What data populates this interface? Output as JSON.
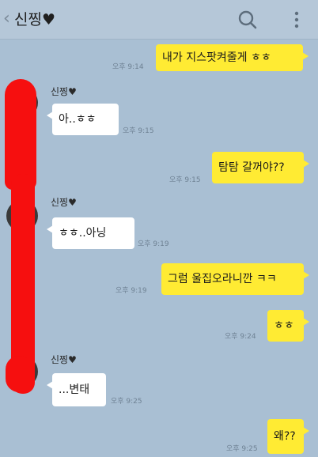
{
  "header": {
    "back_icon": "chevron-left-icon",
    "title": "신찡",
    "title_suffix": "♥",
    "search_icon": "search-icon",
    "menu_icon": "more-vertical-icon"
  },
  "colors": {
    "background": "#a9bfd3",
    "my_bubble": "#ffeb33",
    "their_bubble": "#ffffff",
    "redaction": "#f60f0f"
  },
  "messages": [
    {
      "from": "me",
      "text": "내가 지스팟켜줄게 ㅎㅎ",
      "time": "오후 9:14"
    },
    {
      "from": "them",
      "sender": "신찡♥",
      "text": "아..ㅎㅎ",
      "time": "오후 9:15"
    },
    {
      "from": "me",
      "text": "탐탐 갈꺼야??",
      "time": "오후 9:15"
    },
    {
      "from": "them",
      "sender": "신찡♥",
      "text": "ㅎㅎ..아닝",
      "time": "오후 9:19"
    },
    {
      "from": "me",
      "text": "그럼 울집오라니깐 ㅋㅋ",
      "time": "오후 9:19"
    },
    {
      "from": "me",
      "text": "ㅎㅎ",
      "time": "오후 9:24"
    },
    {
      "from": "them",
      "sender": "신찡♥",
      "text": "...변태",
      "time": "오후 9:25"
    },
    {
      "from": "me",
      "text": "왜??",
      "time": "오후 9:25"
    }
  ]
}
